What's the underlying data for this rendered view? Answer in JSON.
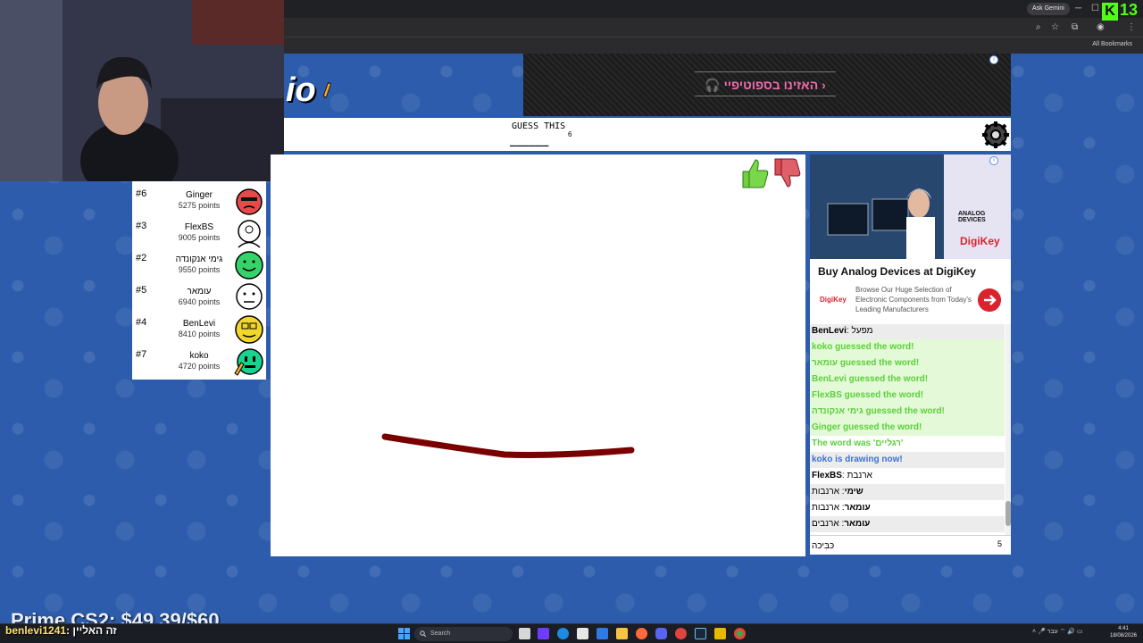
{
  "browser": {
    "ask_gemini": "Ask Gemini",
    "bookmarks": "All Bookmarks",
    "kick_count": "13"
  },
  "game": {
    "logo_text": "io",
    "guess_label": "GUESS THIS",
    "word_hint": "______",
    "word_length": "6"
  },
  "top_ad": {
    "cta": "האזינו בספוטיפיי"
  },
  "players": [
    {
      "rank": "#6",
      "name": "Ginger",
      "points": "5275 points",
      "avatar_color": "#e84a4a"
    },
    {
      "rank": "#3",
      "name": "FlexBS",
      "points": "9005 points",
      "avatar_color": "#ffffff"
    },
    {
      "rank": "#2",
      "name": "גימי אנקונדה",
      "points": "9550 points",
      "avatar_color": "#35d36a"
    },
    {
      "rank": "#5",
      "name": "עומאר",
      "points": "6940 points",
      "avatar_color": "#ffffff"
    },
    {
      "rank": "#4",
      "name": "BenLevi",
      "points": "8410 points",
      "avatar_color": "#f1d62c"
    },
    {
      "rank": "#7",
      "name": "koko",
      "points": "4720 points",
      "avatar_color": "#18d48e"
    }
  ],
  "side_ad": {
    "brand": "ANALOG DEVICES",
    "logo": "DigiKey",
    "title": "Buy Analog Devices at DigiKey",
    "mini_logo": "DigiKey",
    "description": "Browse Our Huge Selection of Electronic Components from Today's Leading Manufacturers"
  },
  "chat": {
    "messages": [
      {
        "author": "BenLevi",
        "text": "מפעל",
        "style": "grey"
      },
      {
        "text": "koko guessed the word!",
        "style": "green"
      },
      {
        "text": "עומאר guessed the word!",
        "style": "green"
      },
      {
        "text": "BenLevi guessed the word!",
        "style": "green"
      },
      {
        "text": "FlexBS guessed the word!",
        "style": "green"
      },
      {
        "text": "גימי אנקונדה guessed the word!",
        "style": "green"
      },
      {
        "text": "Ginger guessed the word!",
        "style": "green"
      },
      {
        "text": "The word was 'רגליים'",
        "style": "green-plain"
      },
      {
        "text": "koko is drawing now!",
        "style": "blue"
      },
      {
        "author": "FlexBS",
        "text": "ארנבת",
        "style": "plain"
      },
      {
        "author": "שימי",
        "text": "ארנבות",
        "style": "grey"
      },
      {
        "author": "עומאר",
        "text": "ארנבות",
        "style": "plain"
      },
      {
        "author": "עומאר",
        "text": "ארנבים",
        "style": "grey"
      }
    ],
    "input_value": "כּבִּיכה",
    "input_count": "5"
  },
  "stream": {
    "goal": "Prime CS2: $49.39/$60",
    "chat_user": "benlevi1241",
    "chat_text": ": זה האליין"
  },
  "taskbar": {
    "search": "Search",
    "time": "4:41",
    "date": "18/08/2026",
    "lang": "עבר"
  },
  "colors": {
    "page_bg": "#2c5cab",
    "green_msg": "#5bd03a",
    "blue_msg": "#3d6fd6",
    "stroke": "#7a0000",
    "ad_accent": "#d9232d"
  }
}
